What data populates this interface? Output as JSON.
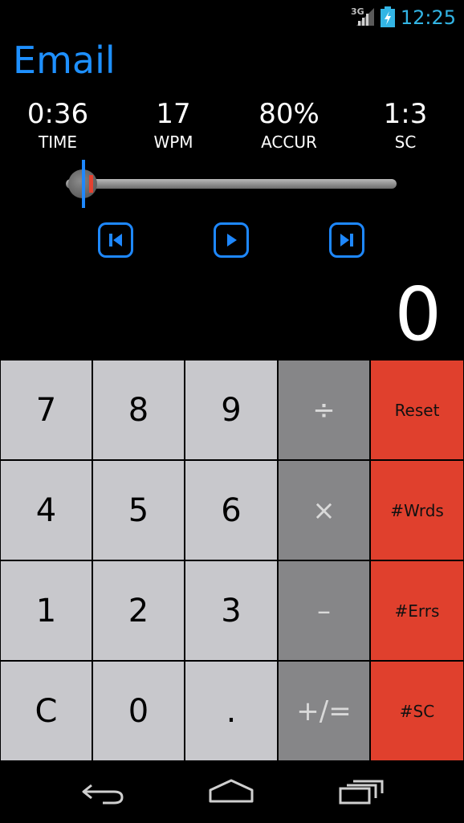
{
  "status_bar": {
    "network": "3G",
    "time": "12:25",
    "signal_icon": "signal-icon",
    "battery_icon": "battery-charging-icon"
  },
  "app": {
    "title": "Email"
  },
  "stats": [
    {
      "value": "0:36",
      "label": "TIME"
    },
    {
      "value": "17",
      "label": "WPM"
    },
    {
      "value": "80%",
      "label": "ACCUR"
    },
    {
      "value": "1:3",
      "label": "SC"
    }
  ],
  "seek": {
    "position_fraction": 0.05
  },
  "transport": {
    "prev_icon": "skip-previous-icon",
    "play_icon": "play-icon",
    "next_icon": "skip-next-icon"
  },
  "display": {
    "value": "0"
  },
  "keypad": {
    "rows": [
      [
        {
          "label": "7",
          "kind": "num"
        },
        {
          "label": "8",
          "kind": "num"
        },
        {
          "label": "9",
          "kind": "num"
        },
        {
          "label": "÷",
          "kind": "op"
        },
        {
          "label": "Reset",
          "kind": "fn"
        }
      ],
      [
        {
          "label": "4",
          "kind": "num"
        },
        {
          "label": "5",
          "kind": "num"
        },
        {
          "label": "6",
          "kind": "num"
        },
        {
          "label": "×",
          "kind": "op"
        },
        {
          "label": "#Wrds",
          "kind": "fn"
        }
      ],
      [
        {
          "label": "1",
          "kind": "num"
        },
        {
          "label": "2",
          "kind": "num"
        },
        {
          "label": "3",
          "kind": "num"
        },
        {
          "label": "–",
          "kind": "op"
        },
        {
          "label": "#Errs",
          "kind": "fn"
        }
      ],
      [
        {
          "label": "C",
          "kind": "num"
        },
        {
          "label": "0",
          "kind": "num"
        },
        {
          "label": ".",
          "kind": "num"
        },
        {
          "label": "+/=",
          "kind": "op"
        },
        {
          "label": "#SC",
          "kind": "fn"
        }
      ]
    ]
  },
  "colors": {
    "accent": "#1e88ff",
    "title": "#1e90ff",
    "clock": "#33b5e5",
    "key_num": "#c8c8cc",
    "key_op": "#868688",
    "key_fn": "#e0402d",
    "seek_marker": "#e5412f"
  },
  "nav": {
    "back_icon": "back-icon",
    "home_icon": "home-icon",
    "recents_icon": "recent-apps-icon"
  }
}
